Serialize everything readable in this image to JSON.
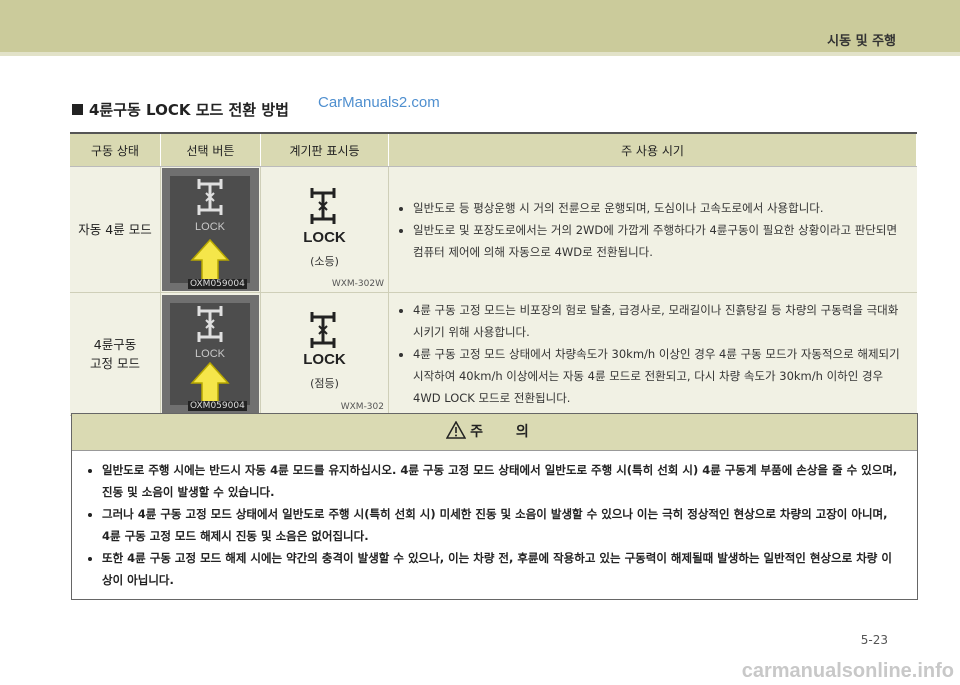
{
  "header": {
    "title": "시동 및 주행"
  },
  "section": {
    "title": "4륜구동 LOCK 모드 전환 방법"
  },
  "watermarks": {
    "top": "CarManuals2.com",
    "bottom": "carmanualsonline.info"
  },
  "table": {
    "headers": [
      "구동 상태",
      "선택 버튼",
      "계기판 표시등",
      "주 사용 시기"
    ],
    "rows": [
      {
        "state": "자동 4륜 모드",
        "button": {
          "label": "LOCK",
          "code": "OXM059004"
        },
        "indicator": {
          "label": "LOCK",
          "caption": "(소등)",
          "code": "WXM-302W"
        },
        "usage": [
          "일반도로 등 평상운행 시 거의 전륜으로 운행되며, 도심이나 고속도로에서 사용합니다.",
          "일반도로 및 포장도로에서는 거의 2WD에 가깝게 주행하다가 4륜구동이 필요한 상황이라고 판단되면 컴퓨터 제어에 의해 자동으로 4WD로 전환됩니다."
        ]
      },
      {
        "state_line1": "4륜구동",
        "state_line2": "고정 모드",
        "button": {
          "label": "LOCK",
          "code": "OXM059004"
        },
        "indicator": {
          "label": "LOCK",
          "caption": "(점등)",
          "code": "WXM-302"
        },
        "usage": [
          "4륜 구동 고정 모드는 비포장의 험로 탈출, 급경사로, 모래길이나 진흙탕길 등 차량의 구동력을 극대화 시키기 위해 사용합니다.",
          "4륜 구동 고정 모드 상태에서 차량속도가 30km/h 이상인 경우 4륜 구동 모드가 자동적으로 해제되기 시작하여 40km/h 이상에서는 자동 4륜 모드로 전환되고, 다시 차량 속도가 30km/h 이하인 경우 4WD LOCK 모드로 전환됩니다."
        ]
      }
    ]
  },
  "caution": {
    "title": "주 의",
    "items": [
      "일반도로 주행 시에는 반드시 자동 4륜 모드를 유지하십시오. 4륜 구동 고정 모드 상태에서 일반도로 주행 시(특히 선회 시) 4륜 구동계 부품에 손상을 줄 수 있으며, 진동 및 소음이 발생할 수 있습니다.",
      "그러나 4륜 구동 고정 모드 상태에서 일반도로 주행 시(특히 선회 시) 미세한 진동 및 소음이 발생할 수 있으나 이는 극히 정상적인 현상으로 차량의 고장이 아니며, 4륜 구동 고정 모드 해제시 진동 및 소음은 없어집니다.",
      "또한 4륜 구동 고정 모드 해제 시에는 약간의 충격이 발생할 수 있으나, 이는 차량 전, 후륜에 작용하고 있는 구동력이 해제될때 발생하는 일반적인 현상으로 차량 이상이 아닙니다."
    ]
  },
  "page_number": "5-23",
  "colors": {
    "header_band": "#cbcb9b",
    "table_header": "#d9d9b2",
    "arrow_yellow": "#f5e64a"
  }
}
